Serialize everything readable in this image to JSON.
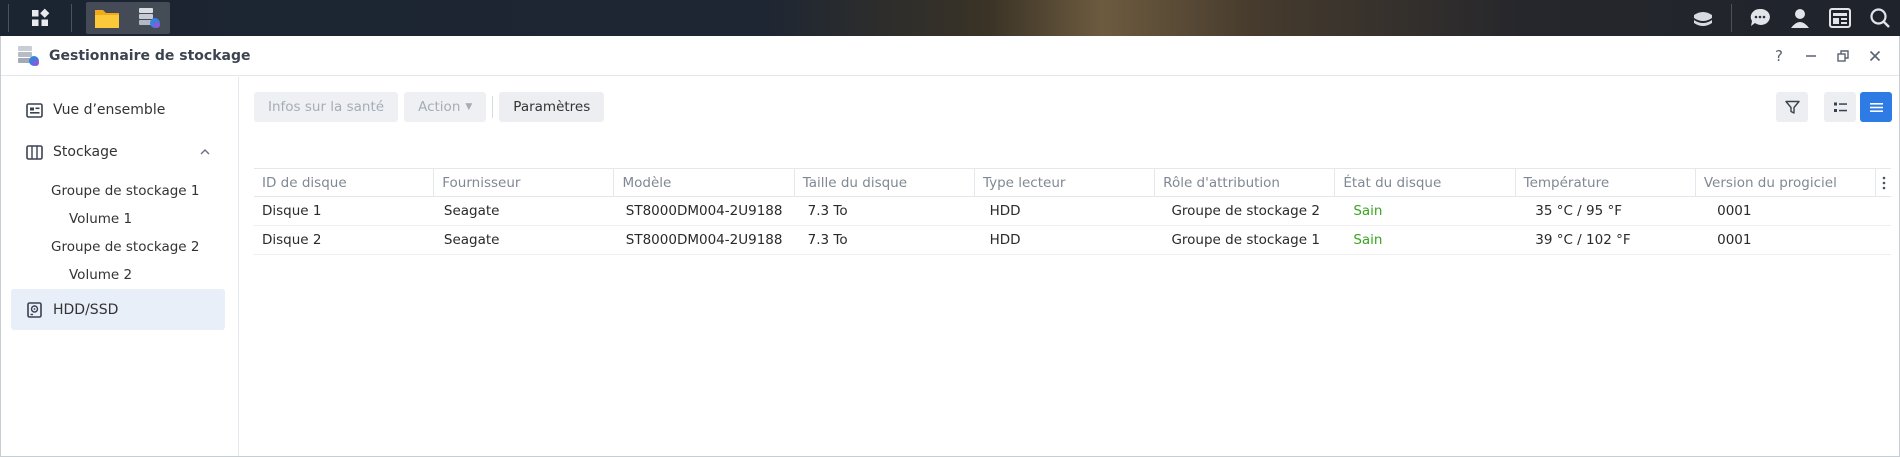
{
  "window": {
    "title": "Gestionnaire de stockage",
    "controls": [
      "?",
      "–",
      "restore",
      "×"
    ]
  },
  "sidebar": {
    "overview": "Vue d’ensemble",
    "storage": "Stockage",
    "groups": [
      {
        "label": "Groupe de stockage 1",
        "volume": "Volume 1"
      },
      {
        "label": "Groupe de stockage 2",
        "volume": "Volume 2"
      }
    ],
    "hdd": "HDD/SSD"
  },
  "toolbar": {
    "health_label": "Infos sur la santé",
    "action_label": "Action",
    "settings_label": "Paramètres"
  },
  "table": {
    "headers": [
      "ID de disque",
      "Fournisseur",
      "Modèle",
      "Taille du disque",
      "Type lecteur",
      "Rôle d'attribution",
      "État du disque",
      "Température",
      "Version du progiciel"
    ],
    "rows": [
      [
        "Disque 1",
        "Seagate",
        "ST8000DM004-2U9188",
        "7.3 To",
        "HDD",
        "Groupe de stockage 2",
        "Sain",
        "35 °C / 95 °F",
        "0001"
      ],
      [
        "Disque 2",
        "Seagate",
        "ST8000DM004-2U9188",
        "7.3 To",
        "HDD",
        "Groupe de stockage 1",
        "Sain",
        "39 °C / 102 °F",
        "0001"
      ]
    ]
  },
  "colors": {
    "accent": "#2f7be5",
    "healthy": "#3aa520",
    "active_bg": "#e8eff9"
  },
  "icons": [
    "main-menu-icon",
    "file-station-icon",
    "storage-manager-icon",
    "storage-icon",
    "chat-icon",
    "user-icon",
    "widgets-icon",
    "search-icon",
    "help-icon",
    "minimize-icon",
    "restore-icon",
    "close-icon",
    "overview-icon",
    "storage-section-icon",
    "chevron-up-icon",
    "hdd-icon",
    "filter-icon",
    "list-view-icon",
    "detail-view-icon",
    "column-menu-icon"
  ]
}
